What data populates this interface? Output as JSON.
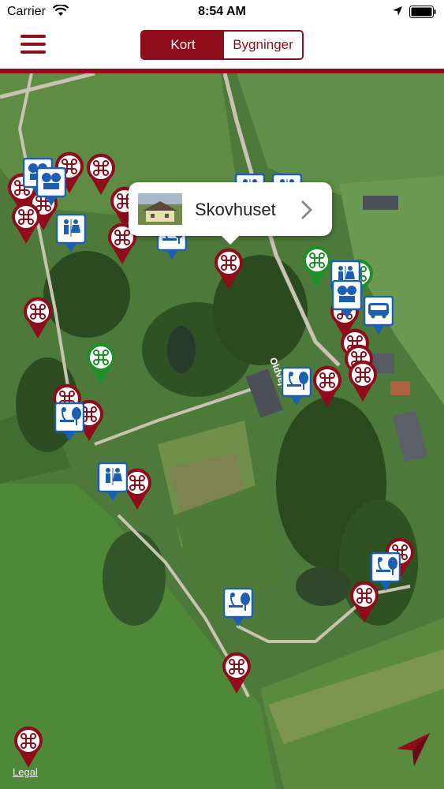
{
  "status_bar": {
    "carrier": "Carrier",
    "time": "8:54 AM"
  },
  "nav": {
    "menu_icon": "hamburger-icon",
    "segments": [
      {
        "label": "Kort",
        "selected": true
      },
      {
        "label": "Bygninger",
        "selected": false
      }
    ]
  },
  "map": {
    "road_label": "Oldvejen",
    "callout": {
      "title": "Skovhuset",
      "thumbnail_icon": "house-thumbnail"
    },
    "legal_link": "Legal",
    "locate_button_icon": "location-arrow-icon"
  },
  "colors": {
    "brand_red": "#8f0d1a",
    "pin_green": "#1f8f2a",
    "pin_blue": "#1a5fb4"
  }
}
